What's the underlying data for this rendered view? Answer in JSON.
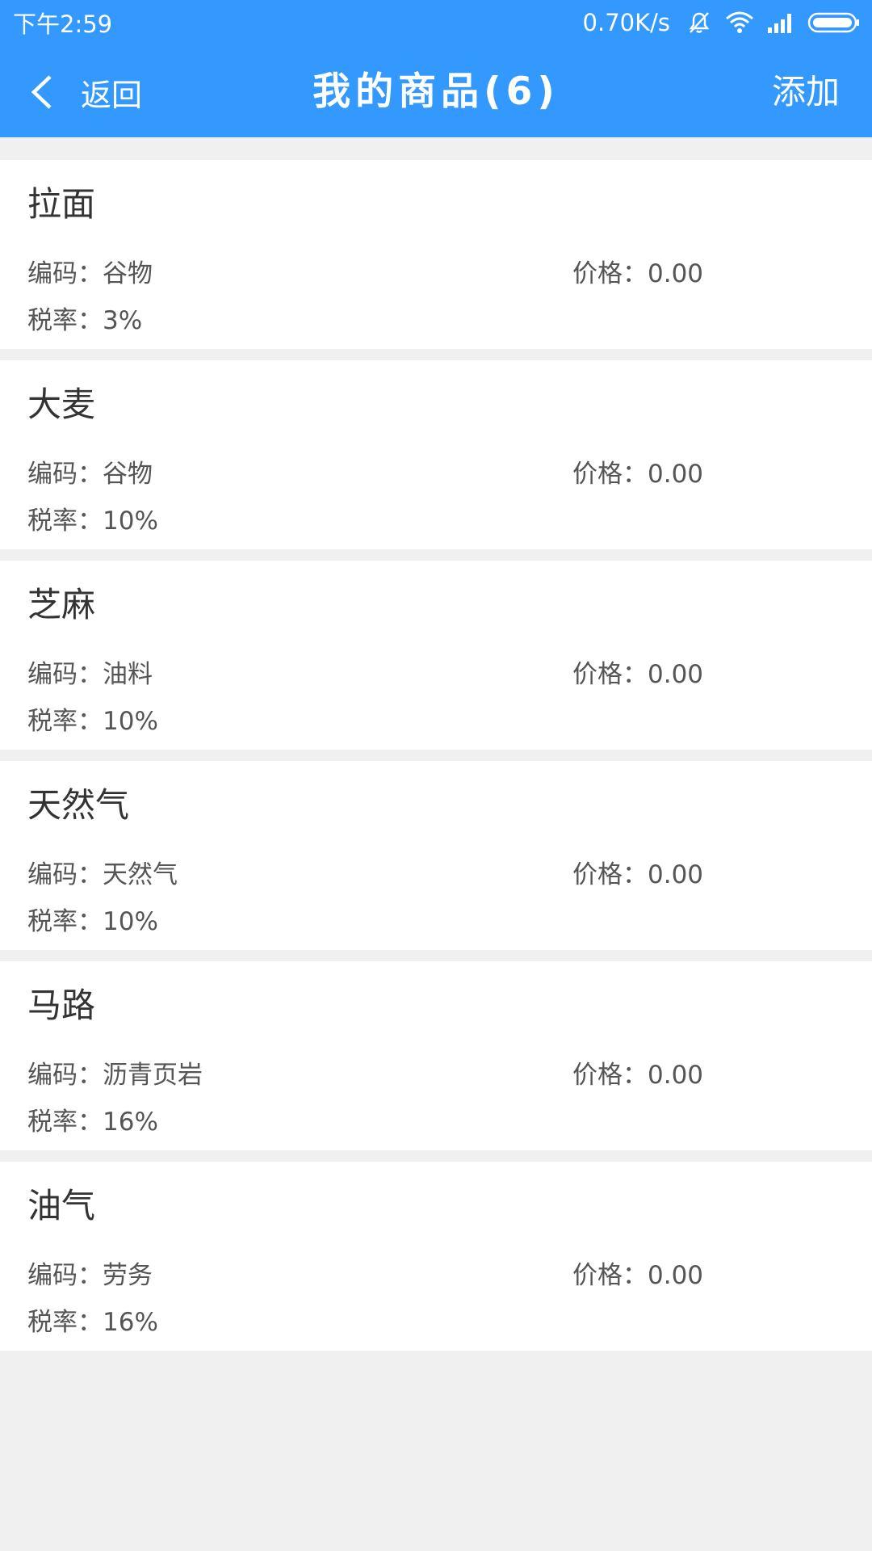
{
  "status_bar": {
    "time": "下午2:59",
    "network_speed": "0.70K/s",
    "icons": [
      "vibrate-mute-icon",
      "wifi-icon",
      "signal-icon",
      "battery-icon"
    ]
  },
  "header": {
    "back_label": "返回",
    "title": "我的商品(6)",
    "add_label": "添加"
  },
  "colors": {
    "accent": "#3399ff",
    "background": "#f0f0f0",
    "card": "#ffffff"
  },
  "products": [
    {
      "name": "拉面",
      "code_label": "编码：",
      "code": "谷物",
      "price_label": "价格：",
      "price": "0.00",
      "tax_label": "税率：",
      "tax": "3%"
    },
    {
      "name": "大麦",
      "code_label": "编码：",
      "code": "谷物",
      "price_label": "价格：",
      "price": "0.00",
      "tax_label": "税率：",
      "tax": "10%"
    },
    {
      "name": "芝麻",
      "code_label": "编码：",
      "code": "油料",
      "price_label": "价格：",
      "price": "0.00",
      "tax_label": "税率：",
      "tax": "10%"
    },
    {
      "name": "天然气",
      "code_label": "编码：",
      "code": "天然气",
      "price_label": "价格：",
      "price": "0.00",
      "tax_label": "税率：",
      "tax": "10%"
    },
    {
      "name": "马路",
      "code_label": "编码：",
      "code": "沥青页岩",
      "price_label": "价格：",
      "price": "0.00",
      "tax_label": "税率：",
      "tax": "16%"
    },
    {
      "name": "油气",
      "code_label": "编码：",
      "code": "劳务",
      "price_label": "价格：",
      "price": "0.00",
      "tax_label": "税率：",
      "tax": "16%"
    }
  ]
}
